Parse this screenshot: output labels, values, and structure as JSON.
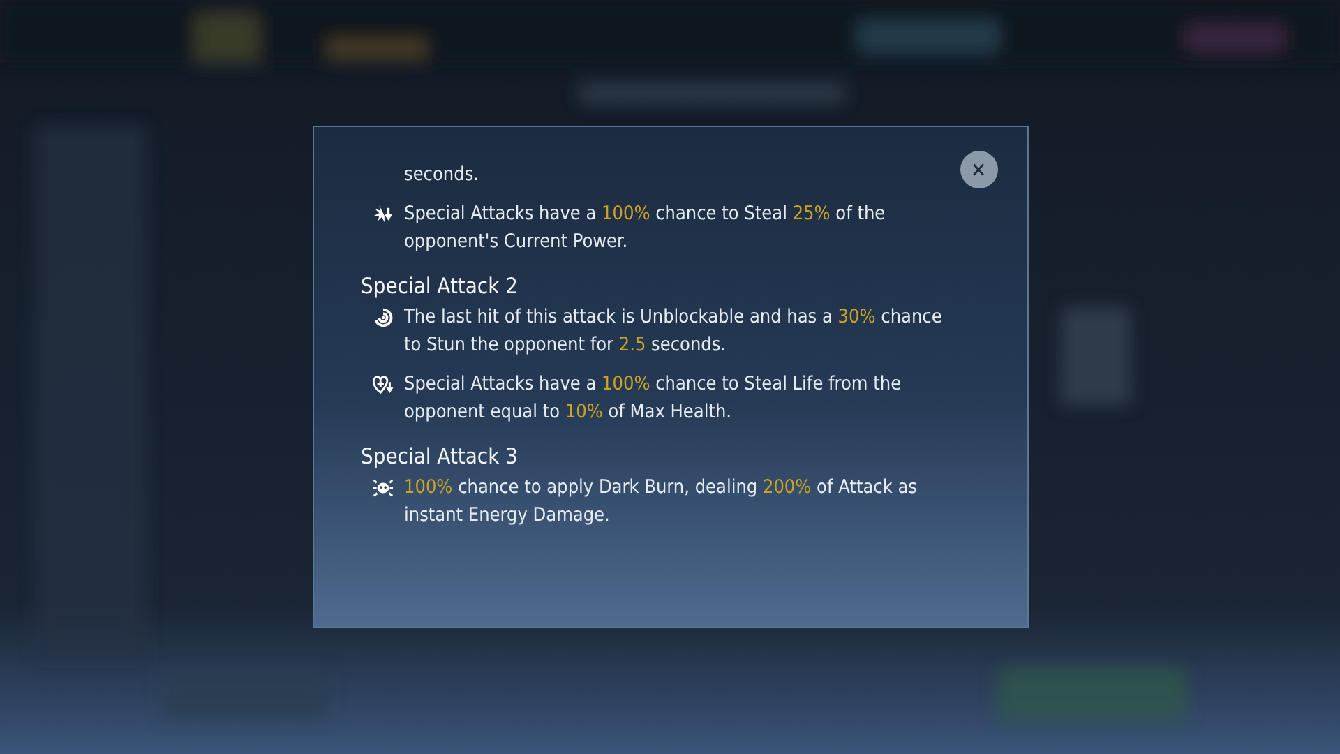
{
  "dialog": {
    "close": "✕",
    "sections": [
      {
        "kind": "tail",
        "text": [
          {
            "t": "seconds.",
            "hl": false
          }
        ]
      },
      {
        "kind": "burst",
        "text": [
          {
            "t": "Special Attacks have a ",
            "hl": false
          },
          {
            "t": "100%",
            "hl": true
          },
          {
            "t": " chance to Steal ",
            "hl": false
          },
          {
            "t": "25%",
            "hl": true
          },
          {
            "t": " of the opponent's Current Power.",
            "hl": false
          }
        ]
      },
      {
        "kind": "heading",
        "title": "Special Attack 2"
      },
      {
        "kind": "swirl",
        "text": [
          {
            "t": "The last hit of this attack is Unblockable and has a ",
            "hl": false
          },
          {
            "t": "30%",
            "hl": true
          },
          {
            "t": " chance to Stun the opponent for ",
            "hl": false
          },
          {
            "t": "2.5",
            "hl": true
          },
          {
            "t": " seconds.",
            "hl": false
          }
        ]
      },
      {
        "kind": "heart",
        "text": [
          {
            "t": "Special Attacks have a ",
            "hl": false
          },
          {
            "t": "100%",
            "hl": true
          },
          {
            "t": " chance to Steal Life from the opponent equal to ",
            "hl": false
          },
          {
            "t": "10%",
            "hl": true
          },
          {
            "t": " of Max Health.",
            "hl": false
          }
        ]
      },
      {
        "kind": "heading",
        "title": "Special Attack 3"
      },
      {
        "kind": "bug",
        "text": [
          {
            "t": "100%",
            "hl": true
          },
          {
            "t": " chance to apply Dark Burn, dealing ",
            "hl": false
          },
          {
            "t": "200%",
            "hl": true
          },
          {
            "t": " of Attack as instant Energy Damage.",
            "hl": false
          }
        ]
      }
    ]
  }
}
